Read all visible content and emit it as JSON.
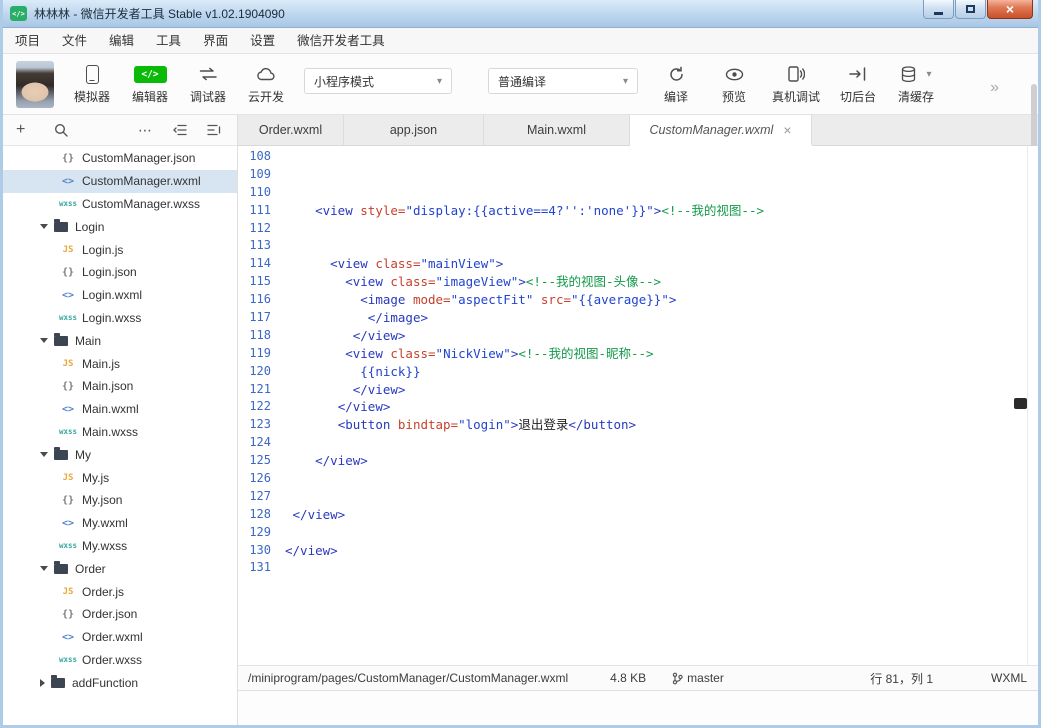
{
  "window": {
    "title": "林林林 - 微信开发者工具 Stable v1.02.1904090"
  },
  "menu": {
    "items": [
      "项目",
      "文件",
      "编辑",
      "工具",
      "界面",
      "设置",
      "微信开发者工具"
    ]
  },
  "toolbar": {
    "simulator": "模拟器",
    "editor": "编辑器",
    "debugger": "调试器",
    "cloud": "云开发",
    "mode_select": "小程序模式",
    "compile_select": "普通编译",
    "compile": "编译",
    "preview": "预览",
    "real_device": "真机调试",
    "background": "切后台",
    "clear_cache": "清缓存"
  },
  "icons": {
    "plus": "+",
    "more": "⋯",
    "caret_down": "▾",
    "chevron_double": "»",
    "tab_close": "×",
    "window_close": "×",
    "code_badge": "</>",
    "app_logo": "</>"
  },
  "colors": {
    "accent_green": "#09bb07",
    "selection_blue": "#d7e5f3",
    "syntax_tag": "#2839bd",
    "syntax_attr": "#c7402d",
    "syntax_string": "#2144cf",
    "syntax_comment": "#149a4a",
    "line_number": "#3a68c4"
  },
  "explorer": {
    "items": [
      {
        "kind": "file",
        "ftype": "json",
        "label": "CustomManager.json",
        "selected": false
      },
      {
        "kind": "file",
        "ftype": "wxml",
        "label": "CustomManager.wxml",
        "selected": true
      },
      {
        "kind": "file",
        "ftype": "wxss",
        "label": "CustomManager.wxss",
        "selected": false
      },
      {
        "kind": "folder",
        "label": "Login",
        "expanded": true
      },
      {
        "kind": "file",
        "ftype": "js",
        "label": "Login.js",
        "selected": false
      },
      {
        "kind": "file",
        "ftype": "json",
        "label": "Login.json",
        "selected": false
      },
      {
        "kind": "file",
        "ftype": "wxml",
        "label": "Login.wxml",
        "selected": false
      },
      {
        "kind": "file",
        "ftype": "wxss",
        "label": "Login.wxss",
        "selected": false
      },
      {
        "kind": "folder",
        "label": "Main",
        "expanded": true
      },
      {
        "kind": "file",
        "ftype": "js",
        "label": "Main.js",
        "selected": false
      },
      {
        "kind": "file",
        "ftype": "json",
        "label": "Main.json",
        "selected": false
      },
      {
        "kind": "file",
        "ftype": "wxml",
        "label": "Main.wxml",
        "selected": false
      },
      {
        "kind": "file",
        "ftype": "wxss",
        "label": "Main.wxss",
        "selected": false
      },
      {
        "kind": "folder",
        "label": "My",
        "expanded": true
      },
      {
        "kind": "file",
        "ftype": "js",
        "label": "My.js",
        "selected": false
      },
      {
        "kind": "file",
        "ftype": "json",
        "label": "My.json",
        "selected": false
      },
      {
        "kind": "file",
        "ftype": "wxml",
        "label": "My.wxml",
        "selected": false
      },
      {
        "kind": "file",
        "ftype": "wxss",
        "label": "My.wxss",
        "selected": false
      },
      {
        "kind": "folder",
        "label": "Order",
        "expanded": true
      },
      {
        "kind": "file",
        "ftype": "js",
        "label": "Order.js",
        "selected": false
      },
      {
        "kind": "file",
        "ftype": "json",
        "label": "Order.json",
        "selected": false
      },
      {
        "kind": "file",
        "ftype": "wxml",
        "label": "Order.wxml",
        "selected": false
      },
      {
        "kind": "file",
        "ftype": "wxss",
        "label": "Order.wxss",
        "selected": false
      },
      {
        "kind": "folder",
        "label": "addFunction",
        "expanded": false
      }
    ]
  },
  "tabs": [
    {
      "label": "Order.wxml",
      "active": false
    },
    {
      "label": "app.json",
      "active": false
    },
    {
      "label": "Main.wxml",
      "active": false
    },
    {
      "label": "CustomManager.wxml",
      "active": true
    }
  ],
  "editor": {
    "lines": [
      {
        "n": 108,
        "segs": []
      },
      {
        "n": 109,
        "segs": []
      },
      {
        "n": 110,
        "segs": []
      },
      {
        "n": 111,
        "segs": [
          [
            "p",
            "    "
          ],
          [
            "t",
            "<view"
          ],
          [
            "a",
            " style="
          ],
          [
            "s",
            "\"display:{{active==4?'':'none'}}\""
          ],
          [
            "t",
            ">"
          ],
          [
            "c",
            "<!--我的视图-->"
          ]
        ]
      },
      {
        "n": 112,
        "segs": []
      },
      {
        "n": 113,
        "segs": []
      },
      {
        "n": 114,
        "segs": [
          [
            "p",
            "      "
          ],
          [
            "t",
            "<view"
          ],
          [
            "a",
            " class="
          ],
          [
            "s",
            "\"mainView\""
          ],
          [
            "t",
            ">"
          ]
        ]
      },
      {
        "n": 115,
        "segs": [
          [
            "p",
            "        "
          ],
          [
            "t",
            "<view"
          ],
          [
            "a",
            " class="
          ],
          [
            "s",
            "\"imageView\""
          ],
          [
            "t",
            ">"
          ],
          [
            "c",
            "<!--我的视图-头像-->"
          ]
        ]
      },
      {
        "n": 116,
        "segs": [
          [
            "p",
            "          "
          ],
          [
            "t",
            "<image"
          ],
          [
            "a",
            " mode="
          ],
          [
            "s",
            "\"aspectFit\""
          ],
          [
            "a",
            " src="
          ],
          [
            "s",
            "\"{{average}}\""
          ],
          [
            "t",
            ">"
          ]
        ]
      },
      {
        "n": 117,
        "segs": [
          [
            "p",
            "           "
          ],
          [
            "t",
            "</image>"
          ]
        ]
      },
      {
        "n": 118,
        "segs": [
          [
            "p",
            "         "
          ],
          [
            "t",
            "</view>"
          ]
        ]
      },
      {
        "n": 119,
        "segs": [
          [
            "p",
            "        "
          ],
          [
            "t",
            "<view"
          ],
          [
            "a",
            " class="
          ],
          [
            "s",
            "\"NickView\""
          ],
          [
            "t",
            ">"
          ],
          [
            "c",
            "<!--我的视图-昵称-->"
          ]
        ]
      },
      {
        "n": 120,
        "segs": [
          [
            "p",
            "          "
          ],
          [
            "s",
            "{{nick}}"
          ]
        ]
      },
      {
        "n": 121,
        "segs": [
          [
            "p",
            "         "
          ],
          [
            "t",
            "</view>"
          ]
        ]
      },
      {
        "n": 122,
        "segs": [
          [
            "p",
            "       "
          ],
          [
            "t",
            "</view>"
          ]
        ]
      },
      {
        "n": 123,
        "segs": [
          [
            "p",
            "       "
          ],
          [
            "t",
            "<button"
          ],
          [
            "a",
            " bindtap="
          ],
          [
            "s",
            "\"login\""
          ],
          [
            "t",
            ">"
          ],
          [
            "x",
            "退出登录"
          ],
          [
            "t",
            "</button>"
          ]
        ]
      },
      {
        "n": 124,
        "segs": []
      },
      {
        "n": 125,
        "segs": [
          [
            "p",
            "    "
          ],
          [
            "t",
            "</view>"
          ]
        ]
      },
      {
        "n": 126,
        "segs": []
      },
      {
        "n": 127,
        "segs": []
      },
      {
        "n": 128,
        "segs": [
          [
            "p",
            " "
          ],
          [
            "t",
            "</view>"
          ]
        ]
      },
      {
        "n": 129,
        "segs": []
      },
      {
        "n": 130,
        "segs": [
          [
            "t",
            "</view>"
          ]
        ]
      },
      {
        "n": 131,
        "segs": []
      }
    ]
  },
  "statusbar": {
    "path": "/miniprogram/pages/CustomManager/CustomManager.wxml",
    "size": "4.8 KB",
    "branch": "master",
    "position": "行 81，列 1",
    "language": "WXML"
  }
}
